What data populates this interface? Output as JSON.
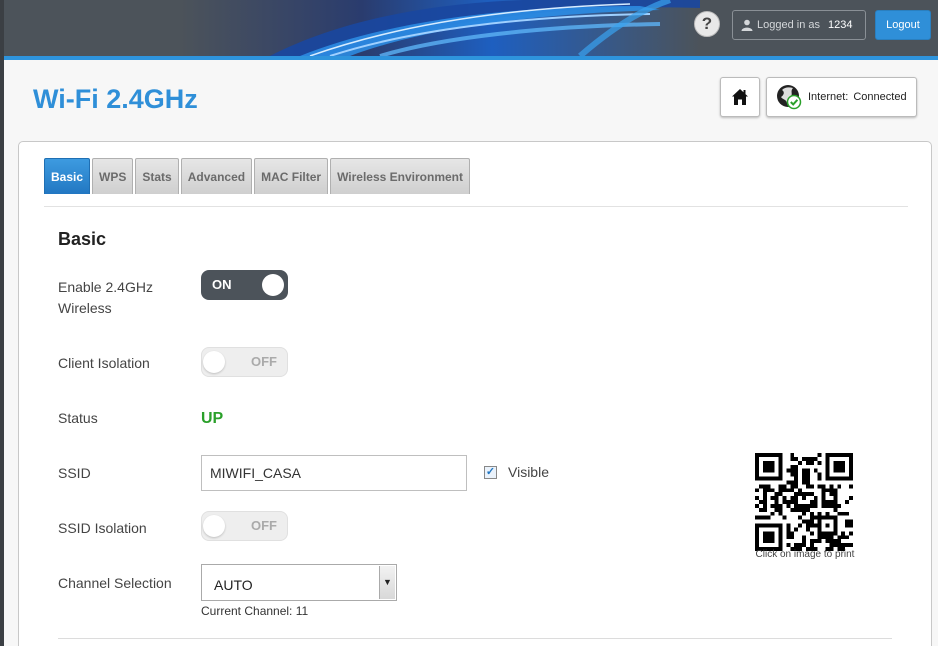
{
  "header": {
    "help_label": "?",
    "logged_in_label": "Logged in as",
    "user": "1234",
    "logout_label": "Logout"
  },
  "page": {
    "title": "Wi-Fi 2.4GHz",
    "internet_label": "Internet:",
    "internet_status": "Connected"
  },
  "tabs": [
    {
      "label": "Basic",
      "active": true
    },
    {
      "label": "WPS"
    },
    {
      "label": "Stats"
    },
    {
      "label": "Advanced"
    },
    {
      "label": "MAC Filter"
    },
    {
      "label": "Wireless Environment"
    }
  ],
  "basic": {
    "section_title": "Basic",
    "enable_label_line1": "Enable 2.4GHz",
    "enable_label_line2": "Wireless",
    "enable_state": "ON",
    "client_isolation_label": "Client Isolation",
    "client_isolation_state": "OFF",
    "status_label": "Status",
    "status_value": "UP",
    "ssid_label": "SSID",
    "ssid_value": "MIWIFI_CASA",
    "visible_label": "Visible",
    "ssid_isolation_label": "SSID Isolation",
    "ssid_isolation_state": "OFF",
    "channel_label": "Channel Selection",
    "channel_value": "AUTO",
    "current_channel": "Current Channel: 11",
    "qr_caption": "Click on image to print"
  },
  "colors": {
    "accent": "#2f8fd8",
    "header_bg": "#4c535a",
    "status_up": "#2aa02a"
  },
  "icons": {
    "help": "question-icon",
    "user": "user-icon",
    "home": "home-icon",
    "internet": "globe-check-icon",
    "dropdown": "chevron-down-icon"
  }
}
